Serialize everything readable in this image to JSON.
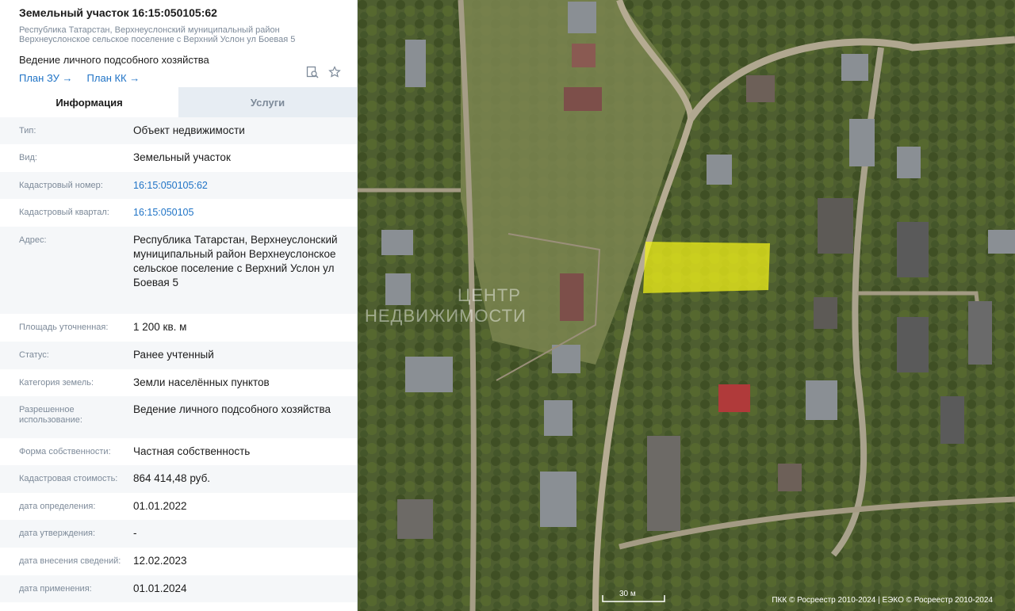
{
  "header": {
    "title": "Земельный участок 16:15:050105:62",
    "address_small_1": "Республика Татарстан, Верхнеуслонский муниципальный район",
    "address_small_2": "Верхнеуслонское сельское поселение с Верхний Услон ул Боевая 5",
    "use": "Ведение личного подсобного хозяйства",
    "link_plan_zu": "План ЗУ →",
    "link_plan_kk": "План КК →"
  },
  "tabs": [
    {
      "label": "Информация"
    },
    {
      "label": "Услуги"
    }
  ],
  "rows": [
    {
      "key": "Тип:",
      "value": "Объект недвижимости"
    },
    {
      "key": "Вид:",
      "value": "Земельный участок"
    },
    {
      "key": "Кадастровый номер:",
      "value": "16:15:050105:62"
    },
    {
      "key": "Кадастровый квартал:",
      "value": "16:15:050105"
    },
    {
      "key": "Адрес:",
      "value": "Республика Татарстан, Верхнеуслонский муниципальный район Верхнеуслонское сельское поселение с Верхний Услон ул Боевая 5"
    },
    {
      "key": "Площадь уточненная:",
      "value": "1 200 кв. м"
    },
    {
      "key": "Статус:",
      "value": "Ранее учтенный"
    },
    {
      "key": "Категория земель:",
      "value": "Земли населённых пунктов"
    },
    {
      "key": "Разрешенное использование:",
      "value": "Ведение личного подсобного хозяйства"
    },
    {
      "key": "Форма собственности:",
      "value": "Частная собственность"
    },
    {
      "key": "Кадастровая стоимость:",
      "value": "864 414,48 руб."
    },
    {
      "key": "дата определения:",
      "value": "01.01.2022"
    },
    {
      "key": "дата утверждения:",
      "value": "-"
    },
    {
      "key": "дата внесения сведений:",
      "value": "12.02.2023"
    },
    {
      "key": "дата применения:",
      "value": "01.01.2024"
    }
  ],
  "map": {
    "watermark_1": "ЦЕНТР",
    "watermark_2": "НЕДВИЖИМОСТИ",
    "scale_label": "30 м",
    "attribution": "ПКК © Росреестр 2010-2024 | ЕЭКО © Росреестр 2010-2024",
    "parcel_color": "#f2f21a"
  }
}
